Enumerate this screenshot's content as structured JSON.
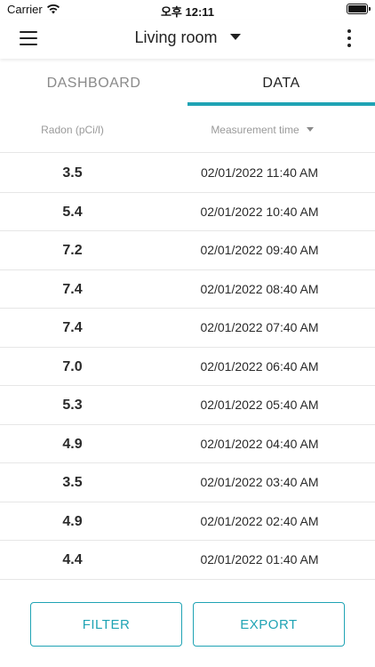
{
  "status_bar": {
    "carrier": "Carrier",
    "time": "오후 12:11",
    "wifi_icon": "wifi-icon",
    "battery_icon": "battery-icon"
  },
  "app_bar": {
    "title": "Living room",
    "menu_icon": "hamburger-menu-icon",
    "dropdown_icon": "chevron-down-icon",
    "more_icon": "more-vertical-icon"
  },
  "tabs": [
    {
      "label": "DASHBOARD",
      "active": false
    },
    {
      "label": "DATA",
      "active": true
    }
  ],
  "colors": {
    "accent": "#1fa3b4",
    "inactive_tab": "#8a8a8a",
    "text": "#2a2a2a",
    "divider": "#e6e6e6"
  },
  "table": {
    "headers": {
      "radon": "Radon (pCi/l)",
      "time": "Measurement time"
    },
    "rows": [
      {
        "radon": "3.5",
        "time": "02/01/2022 11:40 AM"
      },
      {
        "radon": "5.4",
        "time": "02/01/2022 10:40 AM"
      },
      {
        "radon": "7.2",
        "time": "02/01/2022 09:40 AM"
      },
      {
        "radon": "7.4",
        "time": "02/01/2022 08:40 AM"
      },
      {
        "radon": "7.4",
        "time": "02/01/2022 07:40 AM"
      },
      {
        "radon": "7.0",
        "time": "02/01/2022 06:40 AM"
      },
      {
        "radon": "5.3",
        "time": "02/01/2022 05:40 AM"
      },
      {
        "radon": "4.9",
        "time": "02/01/2022 04:40 AM"
      },
      {
        "radon": "3.5",
        "time": "02/01/2022 03:40 AM"
      },
      {
        "radon": "4.9",
        "time": "02/01/2022 02:40 AM"
      },
      {
        "radon": "4.4",
        "time": "02/01/2022 01:40 AM"
      }
    ]
  },
  "actions": {
    "filter_label": "FILTER",
    "export_label": "EXPORT"
  }
}
